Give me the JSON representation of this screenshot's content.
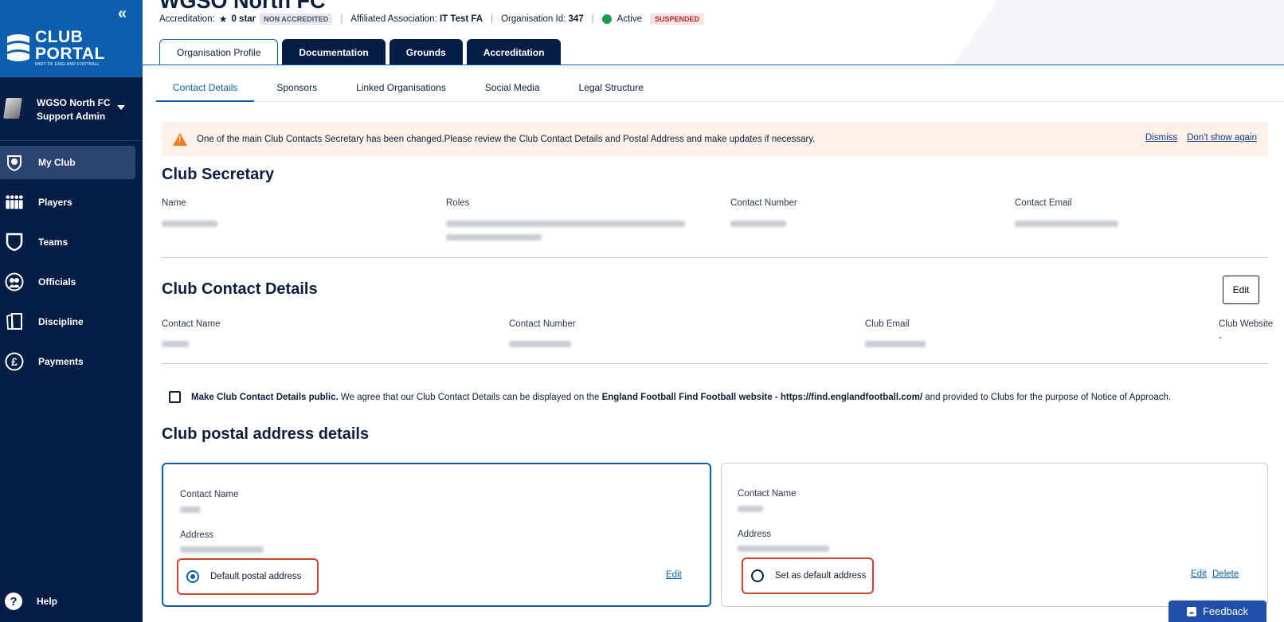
{
  "sidebar": {
    "brand": {
      "line1": "CLUB",
      "line2": "PORTAL",
      "tagline": "PART OF ENGLAND FOOTBALL"
    },
    "account": {
      "club": "WGSO North FC",
      "role": "Support Admin"
    },
    "items": [
      {
        "label": "My Club",
        "icon": "shield-badge-icon",
        "active": true
      },
      {
        "label": "Players",
        "icon": "players-group-icon"
      },
      {
        "label": "Teams",
        "icon": "team-shield-icon"
      },
      {
        "label": "Officials",
        "icon": "officials-icon"
      },
      {
        "label": "Discipline",
        "icon": "card-icon"
      },
      {
        "label": "Payments",
        "icon": "pound-icon"
      }
    ],
    "help": "Help"
  },
  "header": {
    "title": "WGSO North FC",
    "accreditation_label": "Accreditation:",
    "accreditation_value": "0 star",
    "accreditation_badge": "NON ACCREDITED",
    "affiliated_label": "Affiliated Association:",
    "affiliated_value": "IT Test FA",
    "org_id_label": "Organisation Id:",
    "org_id_value": "347",
    "status": "Active",
    "suspended_badge": "SUSPENDED"
  },
  "main_tabs": [
    "Organisation Profile",
    "Documentation",
    "Grounds",
    "Accreditation"
  ],
  "sub_tabs": [
    "Contact Details",
    "Sponsors",
    "Linked Organisations",
    "Social Media",
    "Legal Structure"
  ],
  "alert": {
    "message": "One of the main Club Contacts Secretary has been changed.Please review the Club Contact Details and Postal Address and make updates if necessary.",
    "dismiss": "Dismiss",
    "dont_show": "Don't show again"
  },
  "secretary": {
    "heading": "Club Secretary",
    "labels": [
      "Name",
      "Roles",
      "Contact Number",
      "Contact Email"
    ]
  },
  "contact_details": {
    "heading": "Club Contact Details",
    "edit": "Edit",
    "labels": [
      "Contact Name",
      "Contact Number",
      "Club Email",
      "Club Website"
    ],
    "website_value": "-"
  },
  "public_consent": {
    "bold": "Make Club Contact Details public.",
    "text1": " We agree that our Club Contact Details can be displayed on the ",
    "bold2": "England Football Find Football website - https://find.englandfootball.com/",
    "text2": " and provided to Clubs for the purpose of Notice of Approach."
  },
  "postal": {
    "heading": "Club postal address details",
    "contact_name_label": "Contact Name",
    "address_label": "Address",
    "card1": {
      "radio": "Default postal address",
      "edit": "Edit"
    },
    "card2": {
      "radio": "Set as default address",
      "edit": "Edit",
      "delete": "Delete"
    }
  },
  "feedback": "Feedback",
  "colors": {
    "sidebar": "#061d46",
    "brand": "#0b5fae",
    "accent": "#0b5fae",
    "alert_bg": "#fdf1e9",
    "highlight": "#d0432f"
  }
}
